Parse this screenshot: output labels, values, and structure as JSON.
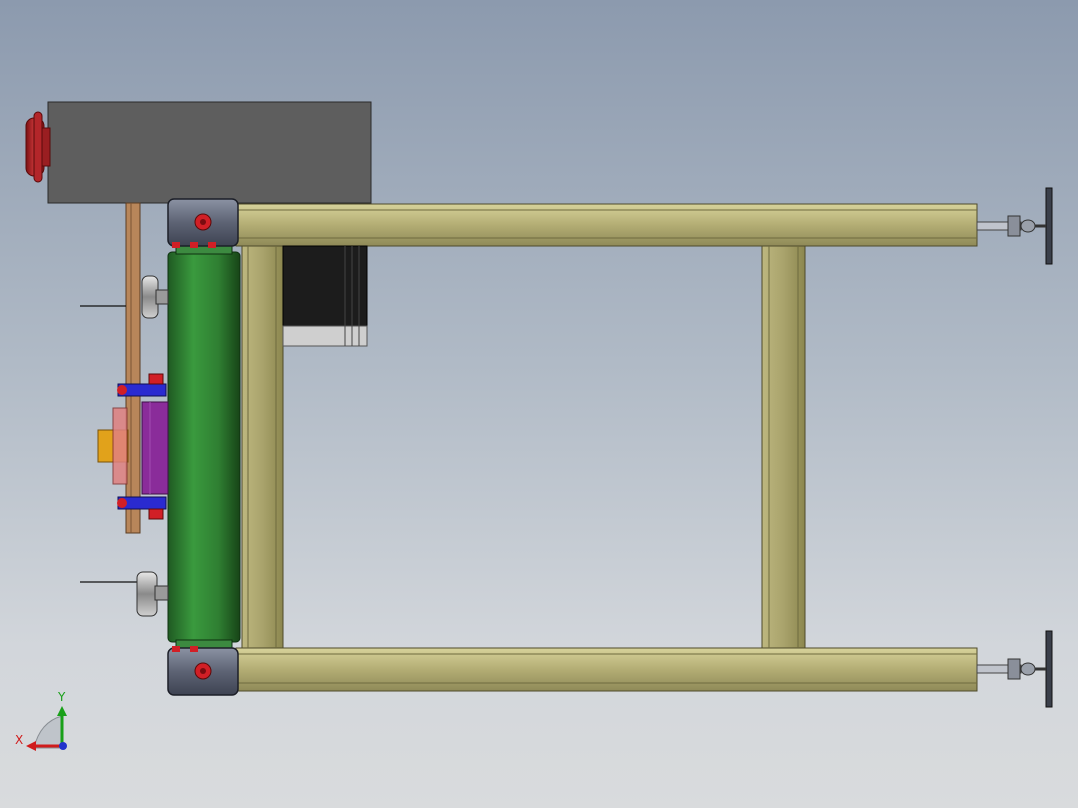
{
  "viewport": {
    "background_top": "#8c9aae",
    "background_bottom": "#d9dbdd"
  },
  "model": {
    "frame_color": "#b6b07a",
    "roller_color": "#2e7d32",
    "motor_color": "#1a1a1a",
    "housing_color": "#5e5e5e",
    "handwheel_color": "#b3262a",
    "bracket_color": "#5a5f6e",
    "accent_purple": "#8a2c9a",
    "accent_yellow": "#e1a21b",
    "accent_blue": "#2a2ad0"
  },
  "triad": {
    "x_label": "X",
    "y_label": "Y",
    "x_color": "#d01c1c",
    "y_color": "#19a019",
    "z_color": "#2233cc"
  }
}
